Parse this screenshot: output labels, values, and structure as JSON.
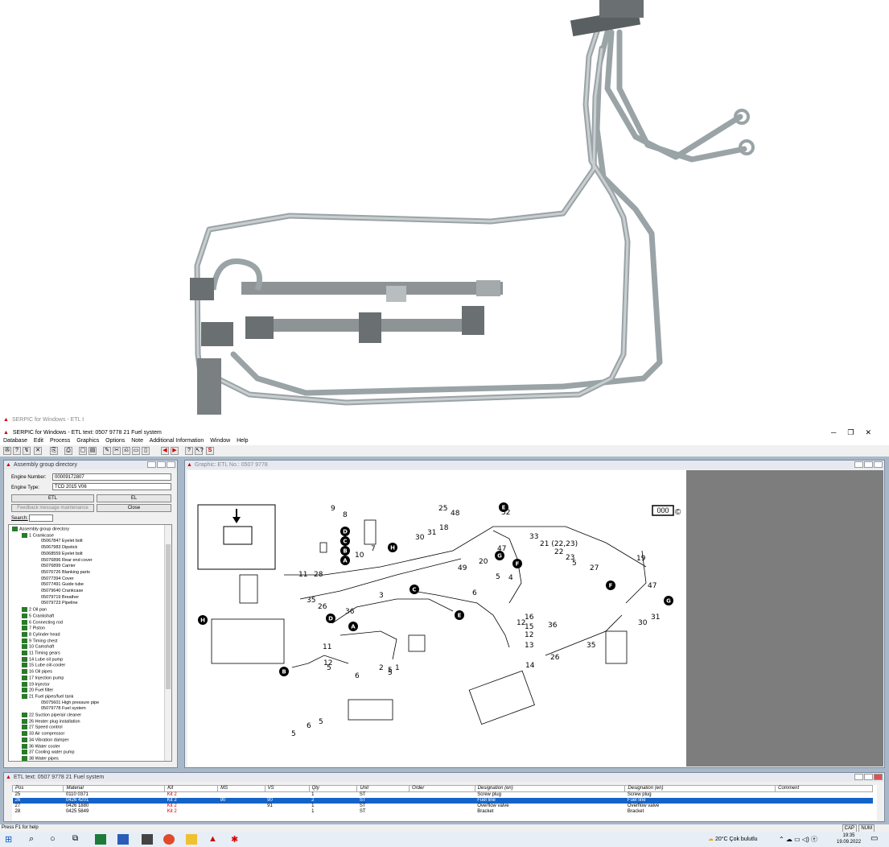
{
  "window": {
    "background_title": "SERPIC for Windows - ETL t",
    "title": "SERPIC for Windows - ETL text: 0507 9778   21  Fuel system"
  },
  "menu": [
    "Database",
    "Edit",
    "Process",
    "Graphics",
    "Options",
    "Note",
    "Additional Information",
    "Window",
    "Help"
  ],
  "assembly": {
    "title": "Assembly group directory",
    "engine_number_label": "Engine Number:",
    "engine_number": "00009172807",
    "engine_type_label": "Engine Type:",
    "engine_type": "TCD 2015 V06",
    "etl_button": "ETL",
    "el_button": "EL",
    "feedback_button": "Feedback message maintenance",
    "close_button": "Close",
    "search_label": "Search:",
    "tree": [
      {
        "level": 0,
        "text": "Assembly group directory"
      },
      {
        "level": 1,
        "text": "1  Crankcase"
      },
      {
        "level": 2,
        "text": "05067847  Eyelet bolt"
      },
      {
        "level": 2,
        "text": "05067983  Dipstick"
      },
      {
        "level": 2,
        "text": "05068559  Eyelet bolt"
      },
      {
        "level": 2,
        "text": "05076896  Rear end cover"
      },
      {
        "level": 2,
        "text": "05076899  Carrier"
      },
      {
        "level": 2,
        "text": "05076726  Blanking parts"
      },
      {
        "level": 2,
        "text": "05077394  Cover"
      },
      {
        "level": 2,
        "text": "05077491  Guide tube"
      },
      {
        "level": 2,
        "text": "05079640  Crankcase"
      },
      {
        "level": 2,
        "text": "05079719  Breather"
      },
      {
        "level": 2,
        "text": "05079723  Pipeline"
      },
      {
        "level": 1,
        "text": "2  Oil pan"
      },
      {
        "level": 1,
        "text": "5  Crankshaft"
      },
      {
        "level": 1,
        "text": "6  Connecting rod"
      },
      {
        "level": 1,
        "text": "7  Piston"
      },
      {
        "level": 1,
        "text": "8  Cylinder head"
      },
      {
        "level": 1,
        "text": "9  Timing chest"
      },
      {
        "level": 1,
        "text": "10  Camshaft"
      },
      {
        "level": 1,
        "text": "11  Timing gears"
      },
      {
        "level": 1,
        "text": "14  Lube oil pump"
      },
      {
        "level": 1,
        "text": "15  Lube oil/-cooler"
      },
      {
        "level": 1,
        "text": "16  Oil pipes"
      },
      {
        "level": 1,
        "text": "17  Injection pump"
      },
      {
        "level": 1,
        "text": "19  Injector"
      },
      {
        "level": 1,
        "text": "20  Fuel filter"
      },
      {
        "level": 1,
        "text": "21  Fuel pipes/fuel tank"
      },
      {
        "level": 2,
        "text": "05075601  High pressure pipe"
      },
      {
        "level": 2,
        "text": "05079778  Fuel system"
      },
      {
        "level": 1,
        "text": "22  Suction pipe/air cleaner"
      },
      {
        "level": 1,
        "text": "26  Heater plug installation"
      },
      {
        "level": 1,
        "text": "27  Speed control"
      },
      {
        "level": 1,
        "text": "33  Air compressor"
      },
      {
        "level": 1,
        "text": "34  Vibration damper"
      },
      {
        "level": 1,
        "text": "36  Water cooler"
      },
      {
        "level": 1,
        "text": "37  Cooling water pump"
      },
      {
        "level": 1,
        "text": "38  Water pipes"
      }
    ]
  },
  "graphic": {
    "title": "Graphic: ETL No.: 0507 9778",
    "badge": "000",
    "callouts": [
      "9",
      "8",
      "25",
      "48",
      "32",
      "18",
      "33",
      "30",
      "31",
      "21 (22,23)",
      "22",
      "23",
      "5",
      "27",
      "19",
      "47",
      "20",
      "49",
      "47",
      "6",
      "4",
      "5",
      "7",
      "10",
      "28",
      "11",
      "35",
      "26",
      "36",
      "3",
      "12",
      "16",
      "15",
      "12",
      "13",
      "14",
      "11",
      "12",
      "6",
      "5",
      "2",
      "5",
      "36",
      "26",
      "35",
      "30",
      "31",
      "5",
      "1",
      "5",
      "6",
      "5",
      "2",
      "6"
    ]
  },
  "etl": {
    "title": "ETL text: 0507 9778   21   Fuel system",
    "columns": [
      "Pos",
      "Material",
      "Kit",
      "MS",
      "VS",
      "Qty",
      "Unit",
      "Order",
      "Designation (en)",
      "Designation (en)",
      "Comment"
    ],
    "rows": [
      [
        "25",
        "0110 0371",
        "Kit 2",
        "",
        "",
        "1",
        "ST",
        "",
        "Screw plug",
        "Screw plug",
        ""
      ],
      [
        "26",
        "0426 4201",
        "Kit 2",
        "90",
        "90",
        "2",
        "ST",
        "",
        "Fuel line",
        "Fuel line",
        ""
      ],
      [
        "27",
        "0426 1880",
        "Kit 2",
        "",
        "91",
        "1",
        "ST",
        "",
        "Overflow valve",
        "Overflow valve",
        ""
      ],
      [
        "28",
        "0425 5849",
        "Kit 2",
        "",
        "",
        "1",
        "ST",
        "",
        "Bracket",
        "Bracket",
        ""
      ]
    ]
  },
  "status": {
    "left": "Press F1 for help",
    "cap": "CAP",
    "num": "NUM"
  },
  "taskbar": {
    "weather": "20°C  Çok bulutlu",
    "time": "19:35",
    "date": "19.09.2022"
  }
}
